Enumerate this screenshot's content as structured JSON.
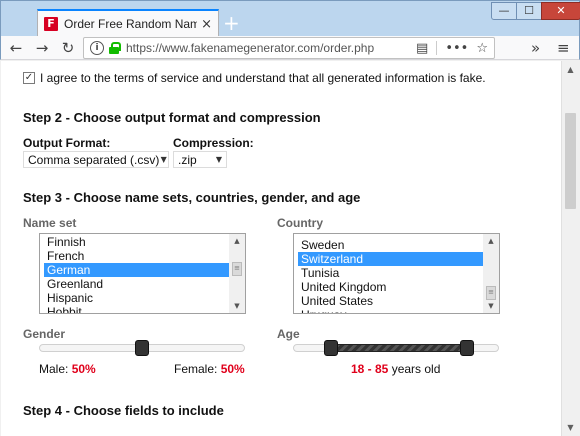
{
  "browser": {
    "tab_title": "Order Free Random Names - Fake Name Generator",
    "favicon_letter": "F",
    "tab_close": "×",
    "new_tab": "+",
    "window_controls": {
      "minimize": "—",
      "maximize": "☐",
      "close": "✕"
    },
    "nav": {
      "back": "←",
      "forward": "→",
      "reload": "↻"
    },
    "url": "https://www.fakenamegenerator.com/order.php",
    "url_icons": {
      "info": "i",
      "reader": "▤",
      "more": "•••",
      "bookmark": "☆",
      "overflow": "»",
      "menu": "≡"
    }
  },
  "page": {
    "agree": {
      "checked": true,
      "checkmark": "✓",
      "text": "I agree to the terms of service and understand that all generated information is fake."
    },
    "step2": {
      "title": "Step 2 - Choose output format and compression",
      "output_format_label": "Output Format:",
      "output_format_value": "Comma separated (.csv)",
      "compression_label": "Compression:",
      "compression_value": ".zip",
      "caret": "▼"
    },
    "step3": {
      "title": "Step 3 - Choose name sets, countries, gender, and age",
      "nameset_label": "Name set",
      "nameset_items": [
        "Finnish",
        "French",
        "German",
        "Greenland",
        "Hispanic",
        "Hobbit"
      ],
      "nameset_selected": "German",
      "country_label": "Country",
      "country_items": [
        "Sweden",
        "Switzerland",
        "Tunisia",
        "United Kingdom",
        "United States",
        "Uruguay"
      ],
      "country_selected": "Switzerland",
      "gender_label": "Gender",
      "gender_male_label": "Male:",
      "gender_male_value": "50%",
      "gender_female_label": "Female:",
      "gender_female_value": "50%",
      "gender_split_fraction": 0.5,
      "age_label": "Age",
      "age_min": 18,
      "age_max": 85,
      "age_slider_min": 0,
      "age_slider_max": 100,
      "age_range_text": "18 - 85",
      "age_suffix": "years old",
      "scroll_up": "▲",
      "scroll_down": "▼",
      "scroll_grip": "≡"
    },
    "step4": {
      "title": "Step 4 - Choose fields to include"
    }
  },
  "scrollbar": {
    "up": "▲",
    "down": "▼"
  }
}
